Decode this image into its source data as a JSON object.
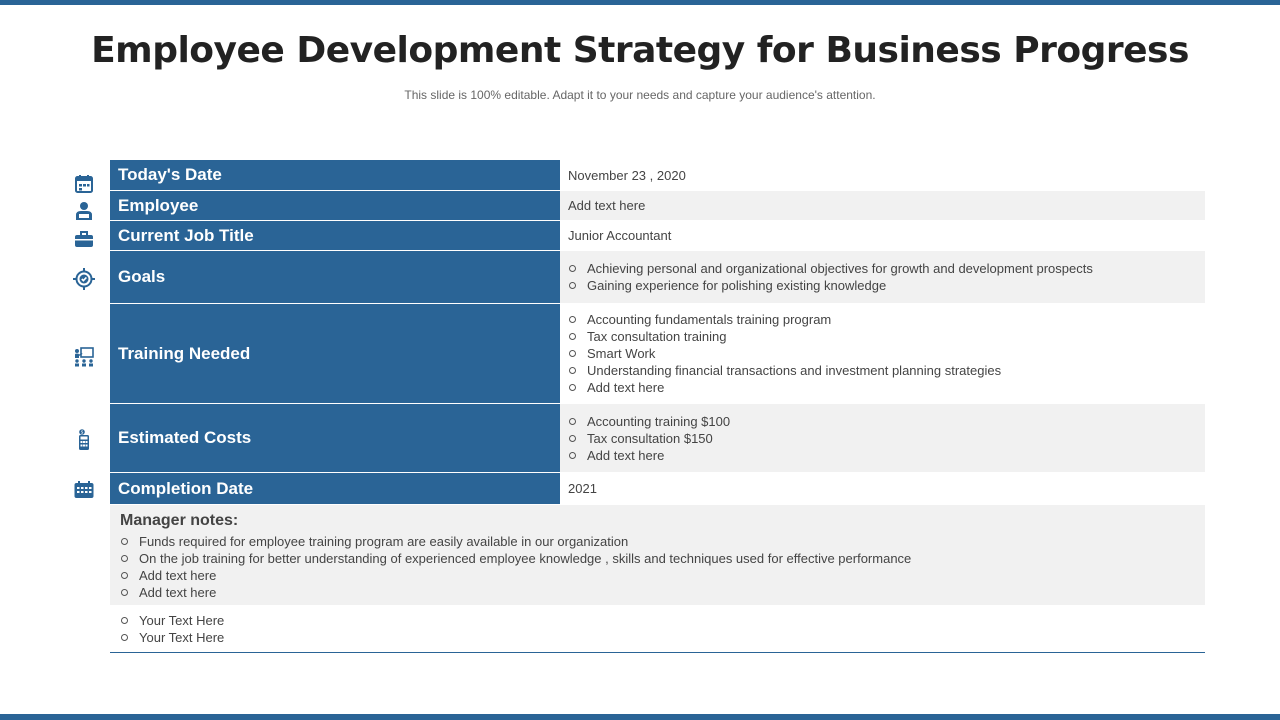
{
  "slide": {
    "title": "Employee Development Strategy for Business Progress",
    "subtitle": "This slide is 100% editable. Adapt it to your needs and capture your audience's attention."
  },
  "colors": {
    "accent": "#2a6496",
    "shade": "#f1f1f1"
  },
  "rows": {
    "todays_date": {
      "icon": "calendar-icon",
      "label": "Today's Date",
      "value": "November 23 , 2020"
    },
    "employee": {
      "icon": "person-icon",
      "label": "Employee",
      "value": "Add text here"
    },
    "job_title": {
      "icon": "briefcase-icon",
      "label": "Current Job Title",
      "value": "Junior Accountant"
    },
    "goals": {
      "icon": "target-icon",
      "label": "Goals",
      "items": [
        "Achieving personal and organizational objectives for growth and development prospects",
        "Gaining experience for polishing existing knowledge"
      ]
    },
    "training": {
      "icon": "presentation-icon",
      "label": "Training Needed",
      "items": [
        "Accounting fundamentals training program",
        "Tax consultation training",
        "Smart Work",
        "Understanding financial transactions and investment planning strategies",
        "Add text here"
      ]
    },
    "costs": {
      "icon": "calculator-icon",
      "label": "Estimated Costs",
      "items": [
        "Accounting training $100",
        "Tax consultation $150",
        "Add text here"
      ]
    },
    "completion": {
      "icon": "calendar-grid-icon",
      "label": "Completion Date",
      "value": "2021"
    }
  },
  "manager_notes": {
    "title": "Manager notes:",
    "items": [
      "Funds required for employee training program are easily available in our organization",
      "On the job training for better understanding of experienced employee knowledge , skills and techniques used for effective performance",
      "Add text here",
      "Add text here"
    ]
  },
  "extra_items": [
    "Your Text Here",
    "Your Text Here"
  ]
}
